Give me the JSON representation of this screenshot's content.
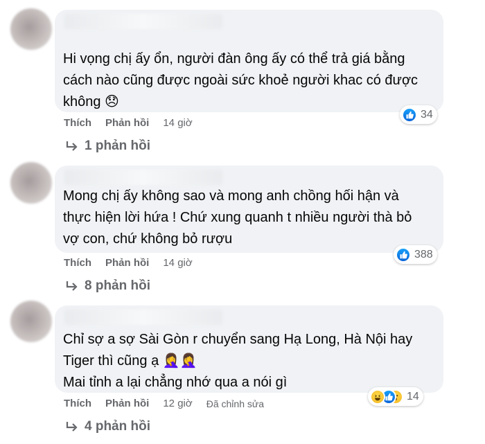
{
  "comments": [
    {
      "lines": [
        "Hi vọng chị ấy ổn, người đàn ông ấy có thể trả giá bằng",
        "cách nào cũng được ngoài sức khoẻ người khac có được",
        "không 😞"
      ],
      "reaction_count": "34",
      "like_label": "Thích",
      "reply_label": "Phản hồi",
      "time": "14 giờ",
      "replies_label": "1 phản hồi"
    },
    {
      "lines": [
        "Mong chị ấy không sao và mong anh chồng hối hận và",
        "thực hiện lời hứa ! Chứ xung quanh t nhiều người thà bỏ",
        "vợ con, chứ không bỏ rượu"
      ],
      "reaction_count": "388",
      "like_label": "Thích",
      "reply_label": "Phản hồi",
      "time": "14 giờ",
      "replies_label": "8 phản hồi"
    },
    {
      "lines": [
        "Chỉ sợ a sợ Sài Gòn r chuyển sang Hạ Long, Hà Nội hay",
        "Tiger thì cũng ạ 🤦‍♀️🤦‍♀️",
        "Mai tỉnh a lại chẳng nhớ qua a nói gì"
      ],
      "reaction_count": "14",
      "like_label": "Thích",
      "reply_label": "Phản hồi",
      "time": "12 giờ",
      "edited_label": "Đã chỉnh sửa",
      "replies_label": "4 phản hồi"
    }
  ],
  "icons": [
    "avatar-blurred",
    "like-reaction-icon",
    "haha-reaction-icon",
    "wow-reaction-icon",
    "reply-arrow-icon"
  ],
  "colors": {
    "bubble": "#f0f2f5",
    "secondary_text": "#65676b",
    "like_blue": "#0a64d8"
  }
}
